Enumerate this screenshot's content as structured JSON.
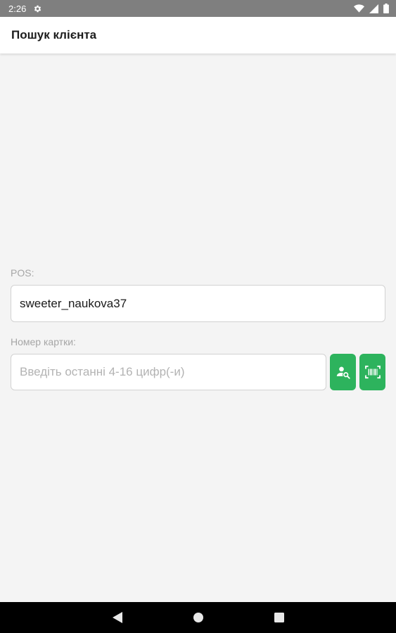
{
  "status_bar": {
    "time": "2:26",
    "icons": [
      "settings-gear-icon",
      "wifi-icon",
      "signal-icon",
      "battery-icon"
    ]
  },
  "app_bar": {
    "title": "Пошук клієнта"
  },
  "pos": {
    "label": "POS:",
    "value": "sweeter_naukova37"
  },
  "card": {
    "label": "Номер картки:",
    "value": "",
    "placeholder": "Введіть останні 4-16 цифр(-и)",
    "buttons": [
      "search-client-icon",
      "barcode-scan-icon"
    ]
  },
  "nav_bar": {
    "buttons": [
      "back-icon",
      "home-icon",
      "recents-icon"
    ]
  },
  "colors": {
    "accent_green": "#2db35d",
    "background": "#f4f4f4",
    "status_bar": "#7f7f7f",
    "nav_bar": "#000000"
  }
}
